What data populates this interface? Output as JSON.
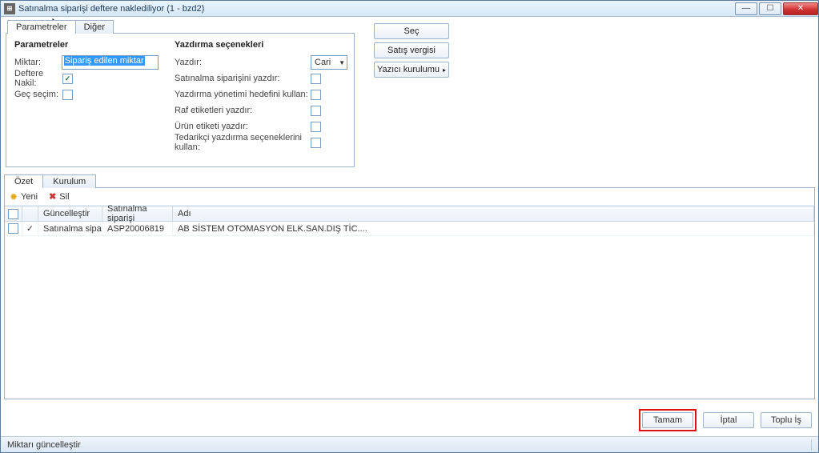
{
  "window": {
    "title": "Satınalma siparişi deftere naklediliyor (1 - bzd2)"
  },
  "tabs": {
    "params": "Parametreler",
    "other": "Diğer"
  },
  "params": {
    "heading": "Parametreler",
    "miktar_label": "Miktar:",
    "miktar_value": "Sipariş edilen miktar",
    "deftere_label": "Deftere Nakil:",
    "gec_label": "Geç seçim:"
  },
  "print": {
    "heading": "Yazdırma seçenekleri",
    "yazdir_label": "Yazdır:",
    "yazdir_value": "Cari",
    "row1": "Satınalma siparişini yazdır:",
    "row2": "Yazdırma yönetimi hedefini kullan:",
    "row3": "Raf etiketleri yazdır:",
    "row4": "Ürün etiketi yazdır:",
    "row5": "Tedarikçi yazdırma seçeneklerini kullan:"
  },
  "right_buttons": {
    "sec": "Seç",
    "vergi": "Satış vergisi",
    "yazici": "Yazıcı kurulumu"
  },
  "lower_tabs": {
    "ozet": "Özet",
    "kurulum": "Kurulum"
  },
  "toolbar": {
    "yeni": "Yeni",
    "sil": "Sil"
  },
  "grid": {
    "headers": {
      "guncelle": "Güncelleştir",
      "po": "Satınalma siparişi",
      "adi": "Adı"
    },
    "row": {
      "guncelle": "Satınalma sipa...",
      "po": "ASP20006819",
      "adi": "AB SİSTEM OTOMASYON ELK.SAN.DIŞ TİC...."
    }
  },
  "footer": {
    "tamam": "Tamam",
    "iptal": "İptal",
    "toplu": "Toplu İş"
  },
  "status": "Miktarı güncelleştir"
}
